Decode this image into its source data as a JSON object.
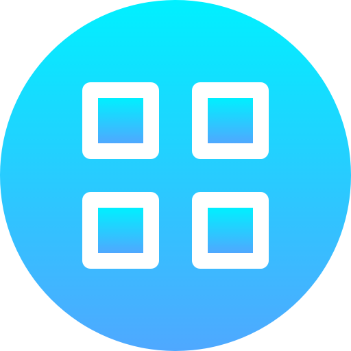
{
  "icon": {
    "name": "grid-menu-icon",
    "colors": {
      "gradient_top": "#00F0FF",
      "gradient_bottom": "#4FA8FF",
      "glyph": "#FFFFFF"
    }
  }
}
